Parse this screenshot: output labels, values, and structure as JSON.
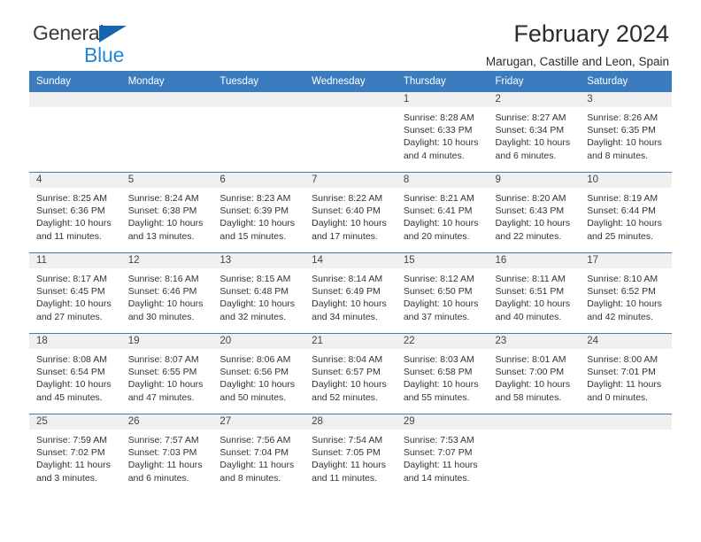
{
  "brand": {
    "name_part1": "General",
    "name_part2": "Blue",
    "accent_color": "#2387d6",
    "triangle_color": "#1565b0"
  },
  "header": {
    "title": "February 2024",
    "subtitle": "Marugan, Castille and Leon, Spain",
    "header_bg_color": "#3a7cbe"
  },
  "weekdays": [
    "Sunday",
    "Monday",
    "Tuesday",
    "Wednesday",
    "Thursday",
    "Friday",
    "Saturday"
  ],
  "weeks": [
    [
      {
        "day": "",
        "sunrise": "",
        "sunset": "",
        "daylight_line1": "",
        "daylight_line2": "",
        "empty": true
      },
      {
        "day": "",
        "sunrise": "",
        "sunset": "",
        "daylight_line1": "",
        "daylight_line2": "",
        "empty": true
      },
      {
        "day": "",
        "sunrise": "",
        "sunset": "",
        "daylight_line1": "",
        "daylight_line2": "",
        "empty": true
      },
      {
        "day": "",
        "sunrise": "",
        "sunset": "",
        "daylight_line1": "",
        "daylight_line2": "",
        "empty": true
      },
      {
        "day": "1",
        "sunrise": "Sunrise: 8:28 AM",
        "sunset": "Sunset: 6:33 PM",
        "daylight_line1": "Daylight: 10 hours",
        "daylight_line2": "and 4 minutes."
      },
      {
        "day": "2",
        "sunrise": "Sunrise: 8:27 AM",
        "sunset": "Sunset: 6:34 PM",
        "daylight_line1": "Daylight: 10 hours",
        "daylight_line2": "and 6 minutes."
      },
      {
        "day": "3",
        "sunrise": "Sunrise: 8:26 AM",
        "sunset": "Sunset: 6:35 PM",
        "daylight_line1": "Daylight: 10 hours",
        "daylight_line2": "and 8 minutes."
      }
    ],
    [
      {
        "day": "4",
        "sunrise": "Sunrise: 8:25 AM",
        "sunset": "Sunset: 6:36 PM",
        "daylight_line1": "Daylight: 10 hours",
        "daylight_line2": "and 11 minutes."
      },
      {
        "day": "5",
        "sunrise": "Sunrise: 8:24 AM",
        "sunset": "Sunset: 6:38 PM",
        "daylight_line1": "Daylight: 10 hours",
        "daylight_line2": "and 13 minutes."
      },
      {
        "day": "6",
        "sunrise": "Sunrise: 8:23 AM",
        "sunset": "Sunset: 6:39 PM",
        "daylight_line1": "Daylight: 10 hours",
        "daylight_line2": "and 15 minutes."
      },
      {
        "day": "7",
        "sunrise": "Sunrise: 8:22 AM",
        "sunset": "Sunset: 6:40 PM",
        "daylight_line1": "Daylight: 10 hours",
        "daylight_line2": "and 17 minutes."
      },
      {
        "day": "8",
        "sunrise": "Sunrise: 8:21 AM",
        "sunset": "Sunset: 6:41 PM",
        "daylight_line1": "Daylight: 10 hours",
        "daylight_line2": "and 20 minutes."
      },
      {
        "day": "9",
        "sunrise": "Sunrise: 8:20 AM",
        "sunset": "Sunset: 6:43 PM",
        "daylight_line1": "Daylight: 10 hours",
        "daylight_line2": "and 22 minutes."
      },
      {
        "day": "10",
        "sunrise": "Sunrise: 8:19 AM",
        "sunset": "Sunset: 6:44 PM",
        "daylight_line1": "Daylight: 10 hours",
        "daylight_line2": "and 25 minutes."
      }
    ],
    [
      {
        "day": "11",
        "sunrise": "Sunrise: 8:17 AM",
        "sunset": "Sunset: 6:45 PM",
        "daylight_line1": "Daylight: 10 hours",
        "daylight_line2": "and 27 minutes."
      },
      {
        "day": "12",
        "sunrise": "Sunrise: 8:16 AM",
        "sunset": "Sunset: 6:46 PM",
        "daylight_line1": "Daylight: 10 hours",
        "daylight_line2": "and 30 minutes."
      },
      {
        "day": "13",
        "sunrise": "Sunrise: 8:15 AM",
        "sunset": "Sunset: 6:48 PM",
        "daylight_line1": "Daylight: 10 hours",
        "daylight_line2": "and 32 minutes."
      },
      {
        "day": "14",
        "sunrise": "Sunrise: 8:14 AM",
        "sunset": "Sunset: 6:49 PM",
        "daylight_line1": "Daylight: 10 hours",
        "daylight_line2": "and 34 minutes."
      },
      {
        "day": "15",
        "sunrise": "Sunrise: 8:12 AM",
        "sunset": "Sunset: 6:50 PM",
        "daylight_line1": "Daylight: 10 hours",
        "daylight_line2": "and 37 minutes."
      },
      {
        "day": "16",
        "sunrise": "Sunrise: 8:11 AM",
        "sunset": "Sunset: 6:51 PM",
        "daylight_line1": "Daylight: 10 hours",
        "daylight_line2": "and 40 minutes."
      },
      {
        "day": "17",
        "sunrise": "Sunrise: 8:10 AM",
        "sunset": "Sunset: 6:52 PM",
        "daylight_line1": "Daylight: 10 hours",
        "daylight_line2": "and 42 minutes."
      }
    ],
    [
      {
        "day": "18",
        "sunrise": "Sunrise: 8:08 AM",
        "sunset": "Sunset: 6:54 PM",
        "daylight_line1": "Daylight: 10 hours",
        "daylight_line2": "and 45 minutes."
      },
      {
        "day": "19",
        "sunrise": "Sunrise: 8:07 AM",
        "sunset": "Sunset: 6:55 PM",
        "daylight_line1": "Daylight: 10 hours",
        "daylight_line2": "and 47 minutes."
      },
      {
        "day": "20",
        "sunrise": "Sunrise: 8:06 AM",
        "sunset": "Sunset: 6:56 PM",
        "daylight_line1": "Daylight: 10 hours",
        "daylight_line2": "and 50 minutes."
      },
      {
        "day": "21",
        "sunrise": "Sunrise: 8:04 AM",
        "sunset": "Sunset: 6:57 PM",
        "daylight_line1": "Daylight: 10 hours",
        "daylight_line2": "and 52 minutes."
      },
      {
        "day": "22",
        "sunrise": "Sunrise: 8:03 AM",
        "sunset": "Sunset: 6:58 PM",
        "daylight_line1": "Daylight: 10 hours",
        "daylight_line2": "and 55 minutes."
      },
      {
        "day": "23",
        "sunrise": "Sunrise: 8:01 AM",
        "sunset": "Sunset: 7:00 PM",
        "daylight_line1": "Daylight: 10 hours",
        "daylight_line2": "and 58 minutes."
      },
      {
        "day": "24",
        "sunrise": "Sunrise: 8:00 AM",
        "sunset": "Sunset: 7:01 PM",
        "daylight_line1": "Daylight: 11 hours",
        "daylight_line2": "and 0 minutes."
      }
    ],
    [
      {
        "day": "25",
        "sunrise": "Sunrise: 7:59 AM",
        "sunset": "Sunset: 7:02 PM",
        "daylight_line1": "Daylight: 11 hours",
        "daylight_line2": "and 3 minutes."
      },
      {
        "day": "26",
        "sunrise": "Sunrise: 7:57 AM",
        "sunset": "Sunset: 7:03 PM",
        "daylight_line1": "Daylight: 11 hours",
        "daylight_line2": "and 6 minutes."
      },
      {
        "day": "27",
        "sunrise": "Sunrise: 7:56 AM",
        "sunset": "Sunset: 7:04 PM",
        "daylight_line1": "Daylight: 11 hours",
        "daylight_line2": "and 8 minutes."
      },
      {
        "day": "28",
        "sunrise": "Sunrise: 7:54 AM",
        "sunset": "Sunset: 7:05 PM",
        "daylight_line1": "Daylight: 11 hours",
        "daylight_line2": "and 11 minutes."
      },
      {
        "day": "29",
        "sunrise": "Sunrise: 7:53 AM",
        "sunset": "Sunset: 7:07 PM",
        "daylight_line1": "Daylight: 11 hours",
        "daylight_line2": "and 14 minutes."
      },
      {
        "day": "",
        "sunrise": "",
        "sunset": "",
        "daylight_line1": "",
        "daylight_line2": "",
        "empty": true
      },
      {
        "day": "",
        "sunrise": "",
        "sunset": "",
        "daylight_line1": "",
        "daylight_line2": "",
        "empty": true
      }
    ]
  ]
}
